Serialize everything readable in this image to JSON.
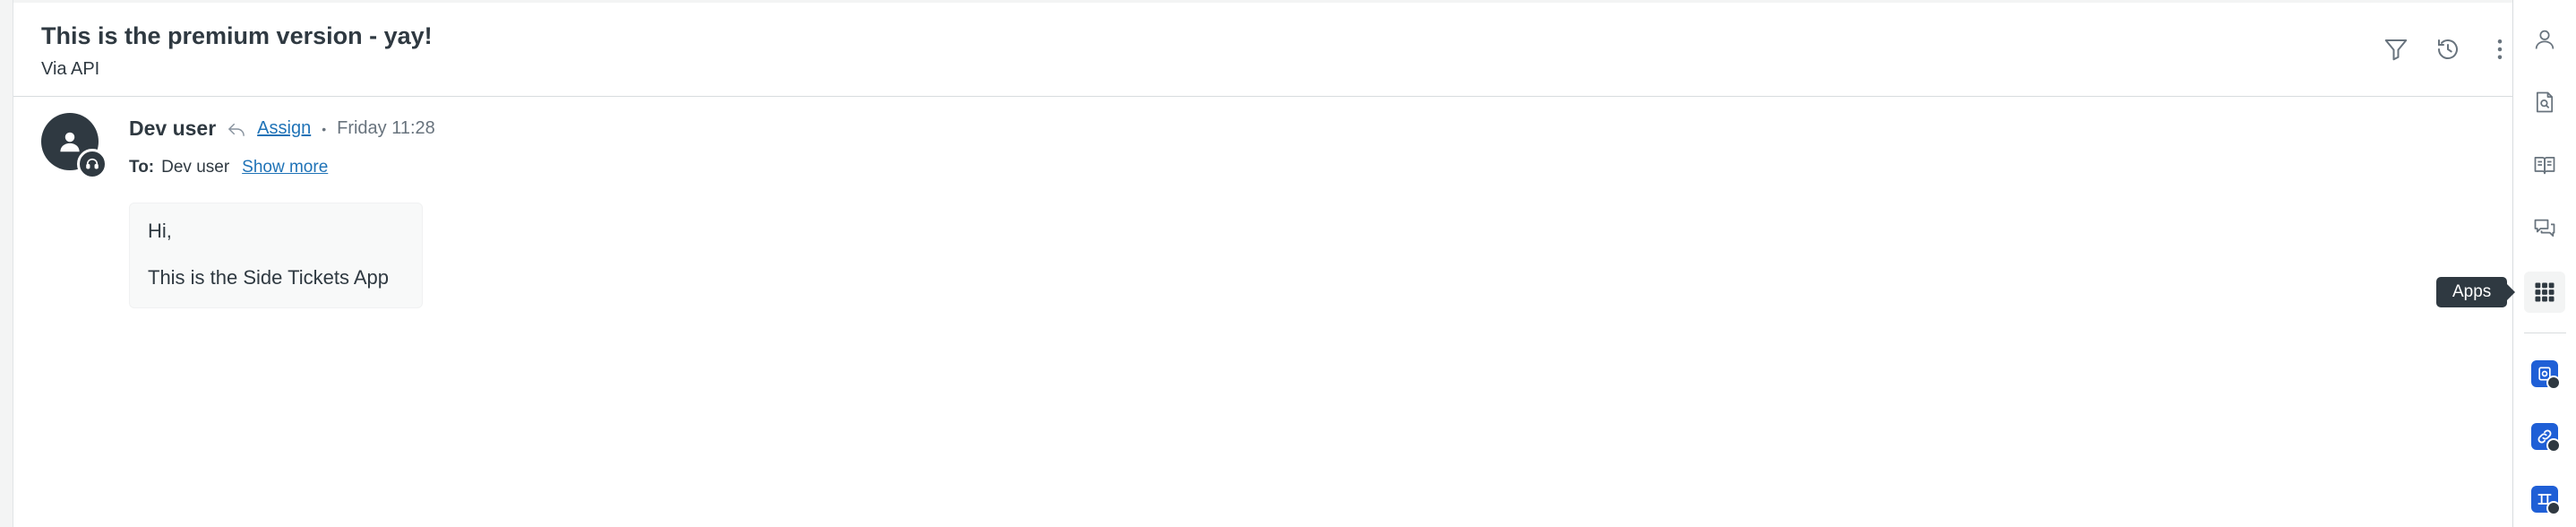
{
  "header": {
    "title": "This is the premium version - yay!",
    "subtitle": "Via API",
    "actions": [
      {
        "icon": "filter-icon",
        "label": "Filter"
      },
      {
        "icon": "history-icon",
        "label": "History"
      },
      {
        "icon": "more-vertical-icon",
        "label": "More"
      }
    ]
  },
  "message": {
    "author": "Dev user",
    "assign_label": "Assign",
    "timestamp": "Friday 11:28",
    "to_label": "To:",
    "to_value": "Dev user",
    "show_more_label": "Show more",
    "body_lines": [
      "Hi,",
      "This is the Side Tickets App"
    ]
  },
  "right_bar": {
    "items": [
      {
        "icon": "user-icon"
      },
      {
        "icon": "knowledge-search-icon"
      },
      {
        "icon": "book-icon"
      },
      {
        "icon": "chat-bubbles-icon"
      },
      {
        "icon": "apps-grid-icon",
        "active": true
      }
    ],
    "apps": [
      {
        "icon": "side-tickets-app-icon"
      },
      {
        "icon": "link-app-icon"
      },
      {
        "icon": "workflow-app-icon"
      }
    ],
    "tooltip": "Apps"
  },
  "colors": {
    "text": "#2f3941",
    "link": "#1f73b7",
    "app_blue": "#1f5fd6",
    "tooltip_bg": "#2f3941",
    "muted": "#68737d"
  }
}
